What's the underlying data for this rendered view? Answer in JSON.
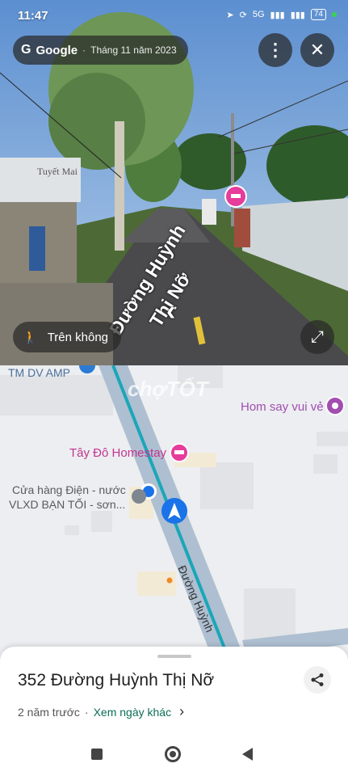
{
  "status_bar": {
    "time": "11:47",
    "network": "5G",
    "battery": "74"
  },
  "street_view": {
    "brand": "Google",
    "date": "Tháng 11 năm 2023",
    "aerial_label": "Trên không",
    "road_label_line1": "Đường Huỳnh",
    "road_label_line2": "Thị Nỡ",
    "shop_sign": "Tuyết Mai"
  },
  "map": {
    "labels": {
      "tm_dv": "TM DV AMP",
      "hom_say": "Hom say vui vẻ",
      "tay_do": "Tây Đô Homestay",
      "store_line1": "Cửa hàng Điện - nước",
      "store_line2": "VLXD BẠN TỐI -  sơn...",
      "road": "Đường Huỳnh"
    },
    "watermark": "chợTỐT"
  },
  "sheet": {
    "address": "352 Đường Huỳnh Thị Nỡ",
    "time_ago": "2 năm trước",
    "see_other_dates": "Xem ngày khác"
  },
  "colors": {
    "poi_pink": "#e63c9b",
    "road_blue": "#aebfd1",
    "location_blue": "#1a73e8"
  }
}
